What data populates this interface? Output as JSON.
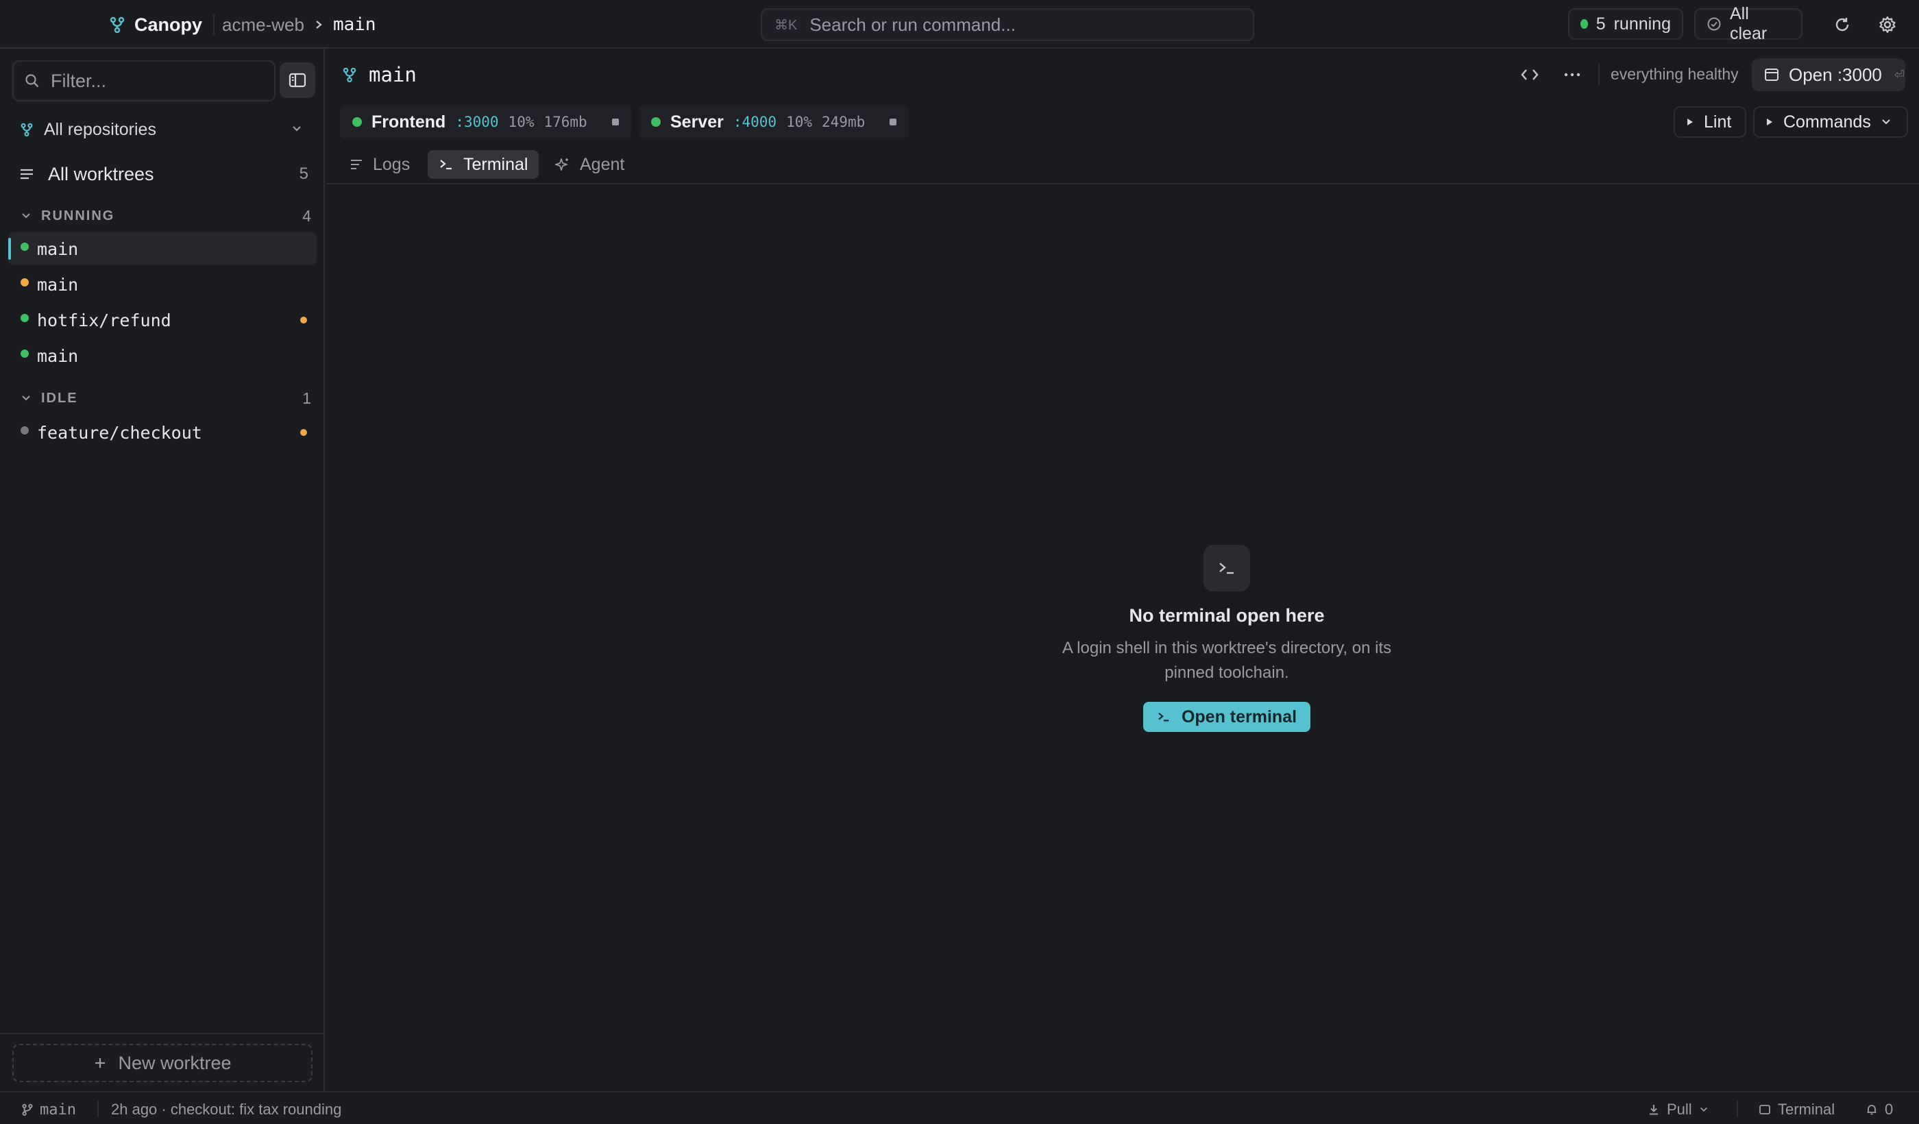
{
  "topbar": {
    "brand": "Canopy",
    "crumb_repo": "acme-web",
    "crumb_branch": "main",
    "search_kbd": "⌘K",
    "search_placeholder": "Search or run command...",
    "running_count": "5",
    "running_label": "running",
    "status_label": "All clear"
  },
  "sidebar": {
    "filter_placeholder": "Filter...",
    "repo_selector": "All repositories",
    "all_worktrees_label": "All worktrees",
    "all_worktrees_count": "5",
    "sections": [
      {
        "title": "RUNNING",
        "count": "4"
      },
      {
        "title": "IDLE",
        "count": "1"
      }
    ],
    "worktrees": [
      {
        "label": "main",
        "status": "running",
        "dot_color": "#3fbf62",
        "active": true,
        "modified": false
      },
      {
        "label": "main",
        "status": "starting",
        "dot_color": "#f0a947",
        "active": false,
        "modified": false
      },
      {
        "label": "hotfix/refund",
        "status": "running",
        "dot_color": "#3fbf62",
        "active": false,
        "modified": true
      },
      {
        "label": "main",
        "status": "running",
        "dot_color": "#3fbf62",
        "active": false,
        "modified": false
      },
      {
        "label": "feature/checkout",
        "status": "idle",
        "dot_color": "#77787f",
        "active": false,
        "modified": true
      }
    ],
    "new_worktree_label": "New worktree"
  },
  "main": {
    "worktree_title": "main",
    "health_text": "everything healthy",
    "open_button_label": "Open :3000",
    "open_button_hint": "⏎",
    "services": [
      {
        "name": "Frontend",
        "port": ":3000",
        "cpu": "10%",
        "mem": "176mb"
      },
      {
        "name": "Server",
        "port": ":4000",
        "cpu": "10%",
        "mem": "249mb"
      }
    ],
    "lint_label": "Lint",
    "commands_label": "Commands",
    "tabs": [
      {
        "label": "Logs",
        "active": false
      },
      {
        "label": "Terminal",
        "active": true
      },
      {
        "label": "Agent",
        "active": false
      }
    ],
    "empty_state": {
      "title": "No terminal open here",
      "description": "A login shell in this worktree's directory, on its pinned toolchain.",
      "button_label": "Open terminal"
    }
  },
  "statusbar": {
    "branch": "main",
    "last_commit": "2h ago · checkout: fix tax rounding",
    "pull_label": "Pull",
    "terminal_label": "Terminal",
    "notifications": "0"
  },
  "colors": {
    "accent": "#56c1cf",
    "running": "#3fbf62",
    "modified": "#f0a947",
    "idle": "#77787f",
    "background": "#1a1b1f"
  }
}
